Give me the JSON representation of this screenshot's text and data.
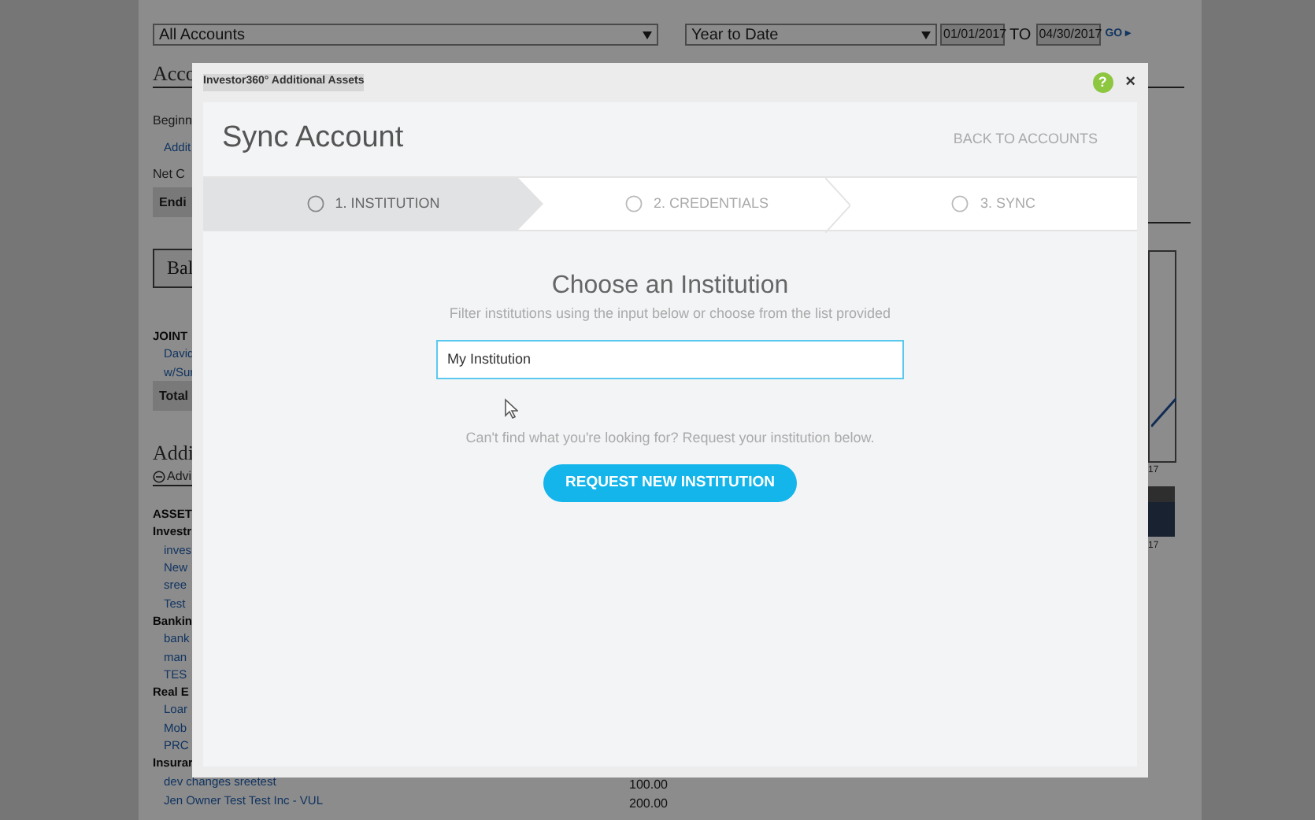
{
  "background": {
    "account_select": "All Accounts",
    "period_select": "Year to Date",
    "start_date": "01/01/2017",
    "to_label": "TO",
    "end_date": "04/30/2017",
    "go_link": "GO ▸",
    "groups": [
      {
        "items": [
          {
            "kind": "heading",
            "text": "Acco"
          },
          {
            "kind": "label",
            "text": "Beginn"
          },
          {
            "kind": "link",
            "text": "Addit"
          },
          {
            "kind": "label",
            "text": "Net C"
          },
          {
            "kind": "total",
            "text": "Endi"
          }
        ]
      },
      {
        "items": [
          {
            "kind": "button",
            "text": "Bal"
          }
        ]
      },
      {
        "items": [
          {
            "kind": "bold",
            "text": "JOINT"
          },
          {
            "kind": "link",
            "text": "David"
          },
          {
            "kind": "link",
            "text": "w/Sur"
          },
          {
            "kind": "total",
            "text": "Total"
          }
        ]
      },
      {
        "items": [
          {
            "kind": "heading",
            "text": "Addi"
          },
          {
            "kind": "toggle",
            "text": "Advi"
          },
          {
            "kind": "bold",
            "text": "ASSET"
          },
          {
            "kind": "bold",
            "text": "Investr"
          },
          {
            "kind": "link",
            "text": "inves"
          },
          {
            "kind": "link",
            "text": "New"
          },
          {
            "kind": "link",
            "text": "sree"
          },
          {
            "kind": "link",
            "text": "Test"
          },
          {
            "kind": "bold",
            "text": "Bankin"
          },
          {
            "kind": "link",
            "text": "bank"
          },
          {
            "kind": "link",
            "text": "man"
          },
          {
            "kind": "link",
            "text": "TES"
          },
          {
            "kind": "bold",
            "text": "Real E"
          },
          {
            "kind": "link",
            "text": "Loar"
          },
          {
            "kind": "link",
            "text": "Mob"
          },
          {
            "kind": "link",
            "text": "PRC"
          },
          {
            "kind": "bold",
            "text": "Insurar"
          },
          {
            "kind": "link",
            "text": "dev changes sreetest",
            "amount": "100.00"
          },
          {
            "kind": "link",
            "text": "Jen Owner Test Test Inc - VUL",
            "amount": "200.00"
          }
        ]
      }
    ],
    "chart_labels": [
      "17",
      "17"
    ]
  },
  "modal": {
    "title": "Investor360° Additional Assets",
    "help": "?",
    "close": "×",
    "heading": "Sync Account",
    "back_link": "BACK TO ACCOUNTS",
    "steps": [
      {
        "label": "1. INSTITUTION",
        "selected": true
      },
      {
        "label": "2. CREDENTIALS",
        "selected": false
      },
      {
        "label": "3. SYNC",
        "selected": false
      }
    ],
    "section_title": "Choose an Institution",
    "instructions": "Filter institutions using the input below or choose from the list provided",
    "search": {
      "value": "My Institution"
    },
    "hint": "Can't find what you're looking for? Request your institution below.",
    "request_button": "REQUEST NEW INSTITUTION"
  }
}
